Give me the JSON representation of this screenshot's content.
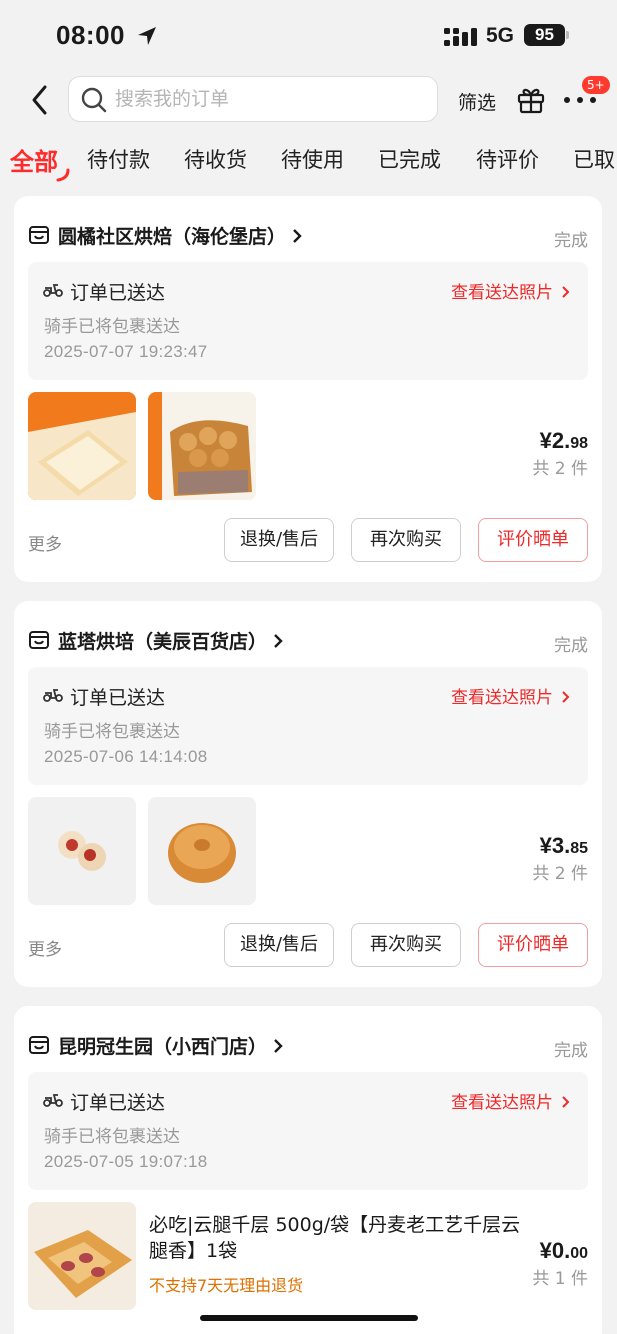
{
  "status_bar": {
    "time": "08:00",
    "network": "5G",
    "battery": "95"
  },
  "header": {
    "search_placeholder": "搜索我的订单",
    "filter_label": "筛选",
    "badge": "5+"
  },
  "tabs": [
    {
      "label": "全部"
    },
    {
      "label": "待付款"
    },
    {
      "label": "待收货"
    },
    {
      "label": "待使用"
    },
    {
      "label": "已完成"
    },
    {
      "label": "待评价"
    },
    {
      "label": "已取"
    }
  ],
  "orders": [
    {
      "shop": "圆橘社区烘焙（海伦堡店）",
      "status": "完成",
      "delivery_title": "订单已送达",
      "delivery_link": "查看送达照片",
      "delivery_sub": "骑手已将包裹送达",
      "delivery_time": "2025-07-07 19:23:47",
      "price_int": "¥2.",
      "price_dec": "98",
      "count": "共 2 件",
      "more": "更多",
      "btn_after_sale": "退换/售后",
      "btn_rebuy": "再次购买",
      "btn_review": "评价晒单"
    },
    {
      "shop": "蓝塔烘培（美辰百货店）",
      "status": "完成",
      "delivery_title": "订单已送达",
      "delivery_link": "查看送达照片",
      "delivery_sub": "骑手已将包裹送达",
      "delivery_time": "2025-07-06 14:14:08",
      "price_int": "¥3.",
      "price_dec": "85",
      "count": "共 2 件",
      "more": "更多",
      "btn_after_sale": "退换/售后",
      "btn_rebuy": "再次购买",
      "btn_review": "评价晒单"
    },
    {
      "shop": "昆明冠生园（小西门店）",
      "status": "完成",
      "delivery_title": "订单已送达",
      "delivery_link": "查看送达照片",
      "delivery_sub": "骑手已将包裹送达",
      "delivery_time": "2025-07-05 19:07:18",
      "item_title": "必吃|云腿千层 500g/袋【丹麦老工艺千层云腿香】1袋",
      "item_note": "不支持7天无理由退货",
      "price_int": "¥0.",
      "price_dec": "00",
      "count": "共 1 件"
    }
  ],
  "colors": {
    "accent": "#ee2a2a",
    "tab_active": "#ff2b2b",
    "background": "#f2f2f2"
  }
}
